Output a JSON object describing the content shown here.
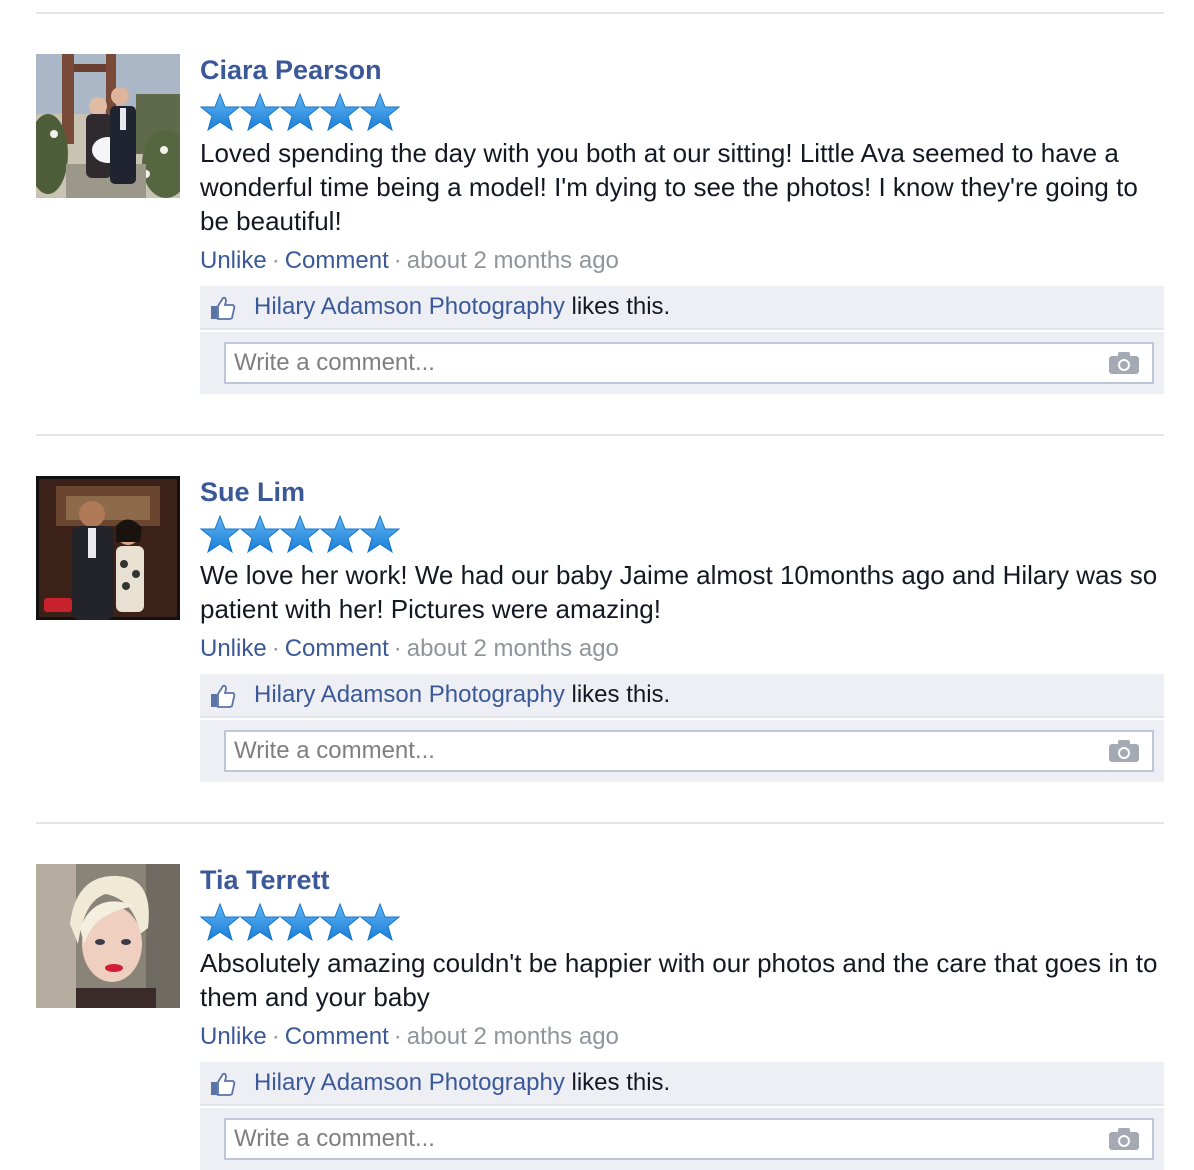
{
  "reviews": [
    {
      "name": "Ciara Pearson",
      "rating": 5,
      "text": "Loved spending the day with you both at our sitting! Little Ava seemed to have a wonderful time being a model! I'm dying to see the photos! I know they're going to be beautiful!",
      "actions": {
        "unlike": "Unlike",
        "comment": "Comment",
        "time": "about 2 months ago"
      },
      "likes": {
        "page": "Hilary Adamson Photography",
        "suffix": "likes this."
      },
      "comment_placeholder": "Write a comment..."
    },
    {
      "name": "Sue Lim",
      "rating": 5,
      "text": "We love her work! We had our baby Jaime almost 10months ago and Hilary was so patient with her! Pictures were amazing!",
      "actions": {
        "unlike": "Unlike",
        "comment": "Comment",
        "time": "about 2 months ago"
      },
      "likes": {
        "page": "Hilary Adamson Photography",
        "suffix": "likes this."
      },
      "comment_placeholder": "Write a comment..."
    },
    {
      "name": "Tia Terrett",
      "rating": 5,
      "text": "Absolutely amazing couldn't be happier with our photos and the care that goes in to them and your baby",
      "actions": {
        "unlike": "Unlike",
        "comment": "Comment",
        "time": "about 2 months ago"
      },
      "likes": {
        "page": "Hilary Adamson Photography",
        "suffix": "likes this."
      },
      "comment_placeholder": "Write a comment..."
    }
  ],
  "icons": {
    "star": "star-icon",
    "like": "thumbs-up-icon",
    "camera": "camera-icon"
  },
  "colors": {
    "link": "#3b5998",
    "star": "#2e8fe0",
    "meta": "#90949c",
    "panel": "#edeff4"
  }
}
